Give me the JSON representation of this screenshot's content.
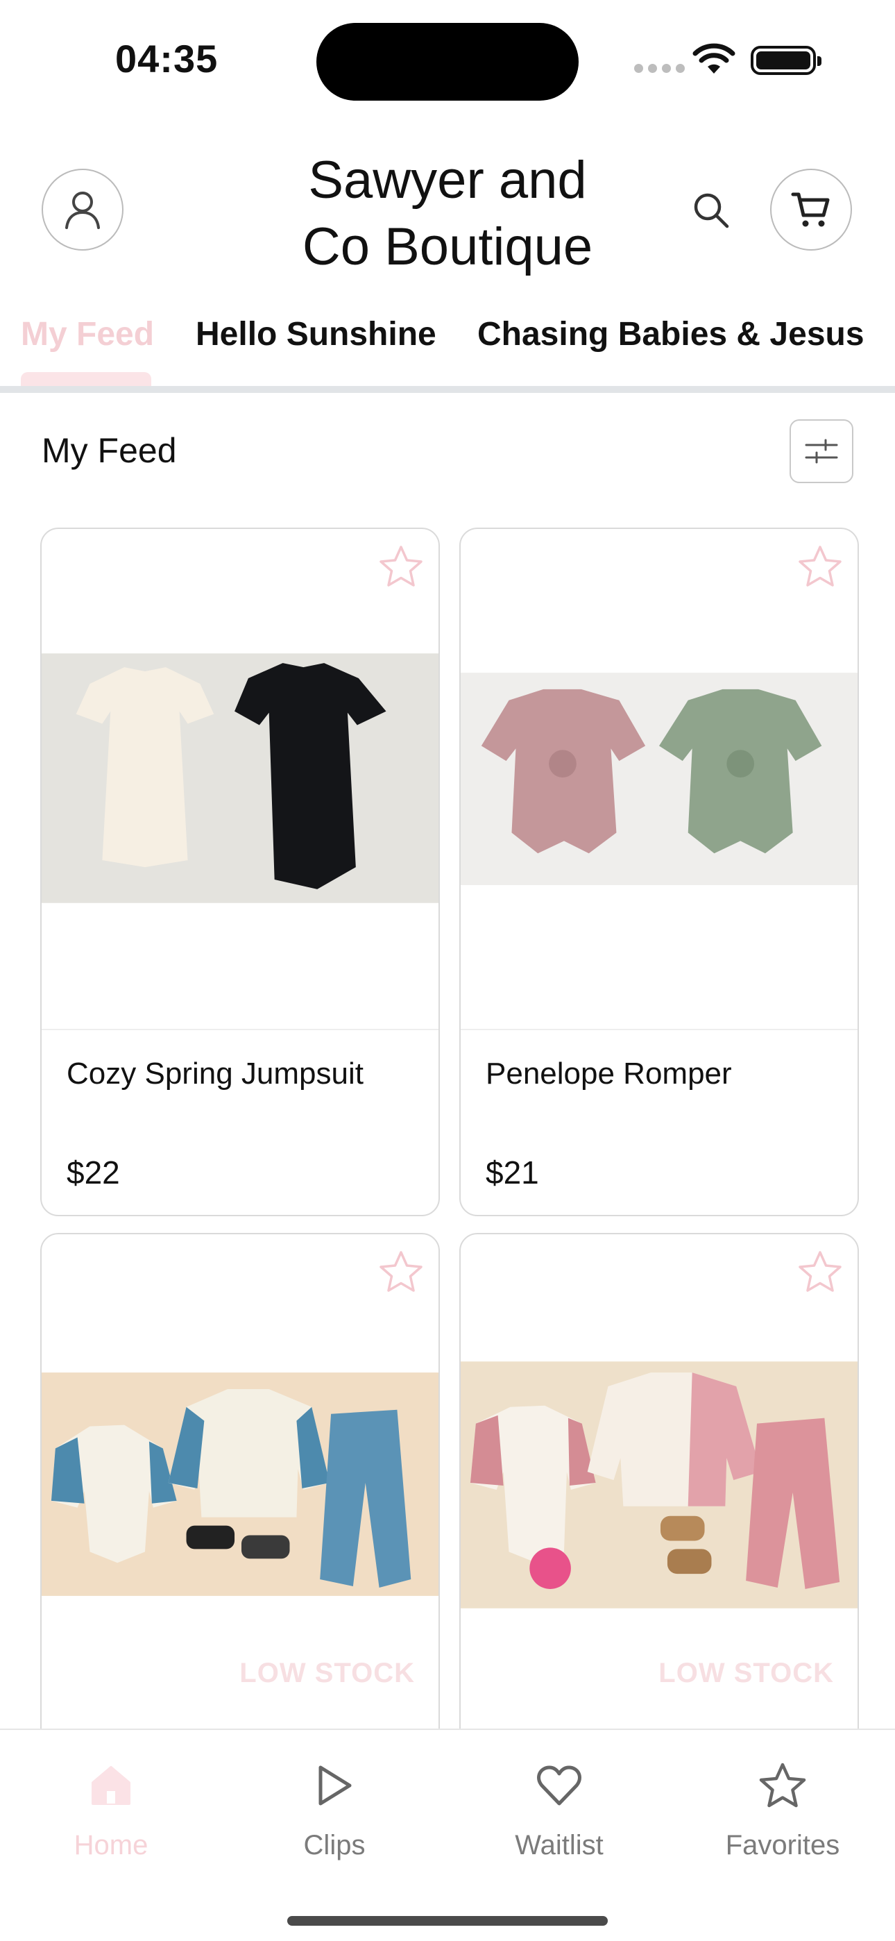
{
  "status_bar": {
    "time": "04:35"
  },
  "header": {
    "store_name_line1": "Sawyer and",
    "store_name_line2": "Co Boutique",
    "account_icon": "person-icon",
    "search_icon": "search-icon",
    "cart_icon": "cart-icon"
  },
  "tabs": [
    {
      "label": "My Feed",
      "active": true
    },
    {
      "label": "Hello Sunshine",
      "active": false
    },
    {
      "label": "Chasing Babies & Jesus",
      "active": false
    }
  ],
  "section": {
    "title": "My Feed",
    "filter_icon": "sliders-icon"
  },
  "products": [
    {
      "name": "Cozy Spring Jumpsuit",
      "price": "$22",
      "badge": ""
    },
    {
      "name": "Penelope Romper",
      "price": "$21",
      "badge": ""
    },
    {
      "name": "",
      "price": "",
      "badge": "LOW STOCK"
    },
    {
      "name": "",
      "price": "",
      "badge": "LOW STOCK"
    }
  ],
  "bottom_nav": [
    {
      "label": "Home",
      "icon": "home-icon",
      "active": true
    },
    {
      "label": "Clips",
      "icon": "play-icon",
      "active": false
    },
    {
      "label": "Waitlist",
      "icon": "heart-icon",
      "active": false
    },
    {
      "label": "Favorites",
      "icon": "star-icon",
      "active": false
    }
  ],
  "colors": {
    "accent_pink": "#f4cfd4",
    "tab_underline": "#fbe4e7",
    "nav_inactive": "#7b7b7b"
  }
}
